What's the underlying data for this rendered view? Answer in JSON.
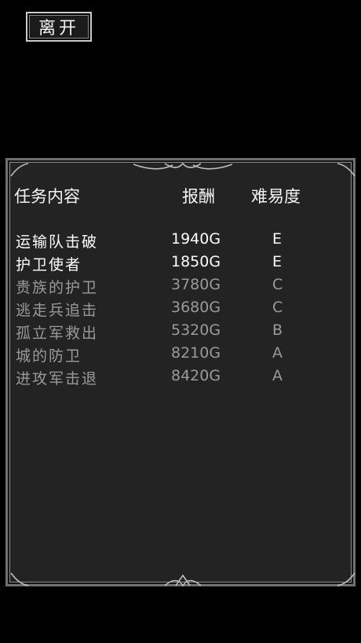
{
  "leave_button": {
    "label": "离开"
  },
  "panel": {
    "headers": {
      "name": "任务内容",
      "reward": "报酬",
      "difficulty": "难易度"
    },
    "missions": [
      {
        "name": "运输队击破",
        "reward": "1940G",
        "difficulty": "E",
        "available": true
      },
      {
        "name": "护卫使者",
        "reward": "1850G",
        "difficulty": "E",
        "available": true
      },
      {
        "name": "贵族的护卫",
        "reward": "3780G",
        "difficulty": "C",
        "available": false
      },
      {
        "name": "逃走兵追击",
        "reward": "3680G",
        "difficulty": "C",
        "available": false
      },
      {
        "name": "孤立军救出",
        "reward": "5320G",
        "difficulty": "B",
        "available": false
      },
      {
        "name": "城的防卫",
        "reward": "8210G",
        "difficulty": "A",
        "available": false
      },
      {
        "name": "进攻军击退",
        "reward": "8420G",
        "difficulty": "A",
        "available": false
      }
    ]
  },
  "colors": {
    "background": "#000000",
    "panel": "#232323",
    "active_text": "#ffffff",
    "inactive_text": "#9a9a9a"
  }
}
